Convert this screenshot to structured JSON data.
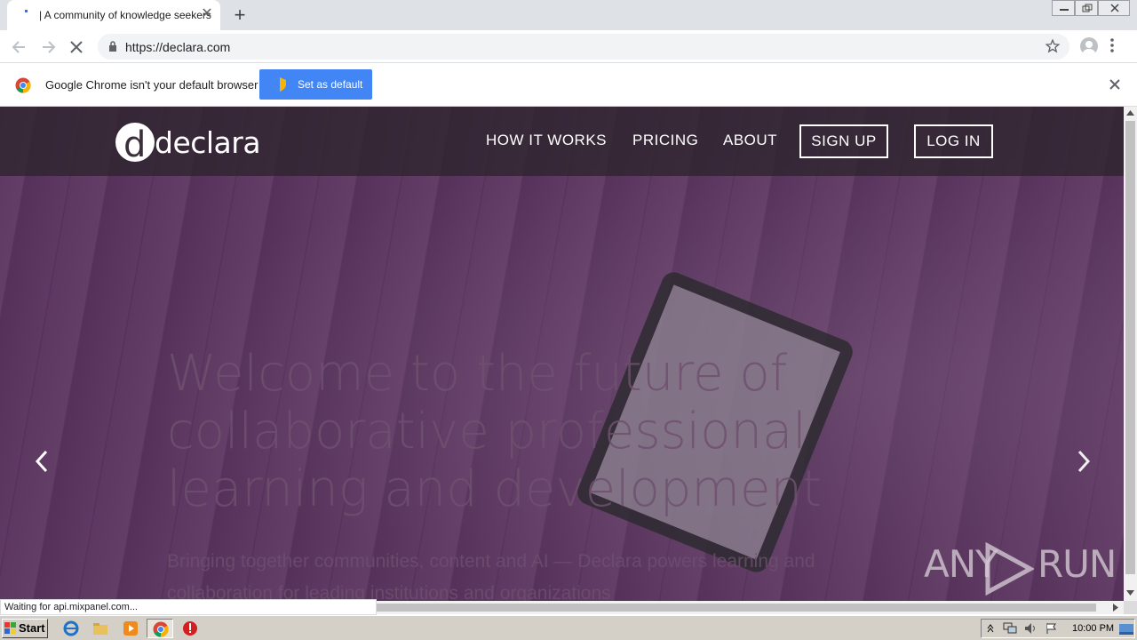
{
  "browser": {
    "tab_title": "| A community of knowledge seekers",
    "url": "https://declara.com",
    "infobar_text": "Google Chrome isn't your default browser",
    "set_default_label": "Set as default",
    "status_text": "Waiting for api.mixpanel.com..."
  },
  "site": {
    "logo_text": "declara",
    "logo_mark": "d",
    "nav": {
      "how_it_works": "HOW IT WORKS",
      "pricing": "PRICING",
      "about": "ABOUT",
      "sign_up": "SIGN UP",
      "log_in": "LOG IN"
    },
    "hero_title": "Welcome to the future of collaborative professional learning and development",
    "hero_sub": "Bringing together communities, content and AI — Declara powers learning and collaboration for leading institutions and organizations"
  },
  "watermark": {
    "left": "ANY",
    "right": "RUN"
  },
  "taskbar": {
    "start_label": "Start",
    "clock": "10:00 PM"
  },
  "colors": {
    "accent": "#4285f4",
    "hero_overlay": "#503c5a"
  }
}
